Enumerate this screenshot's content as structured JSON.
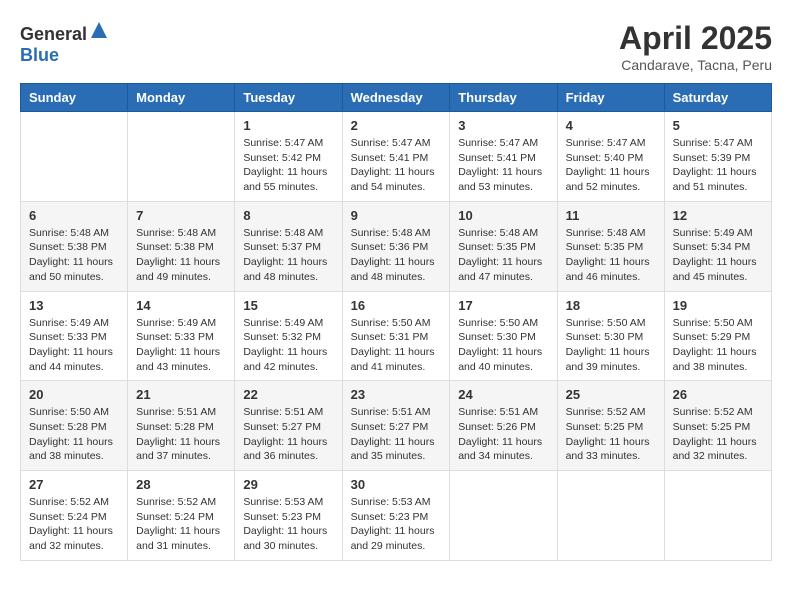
{
  "header": {
    "logo_general": "General",
    "logo_blue": "Blue",
    "title": "April 2025",
    "subtitle": "Candarave, Tacna, Peru"
  },
  "days_of_week": [
    "Sunday",
    "Monday",
    "Tuesday",
    "Wednesday",
    "Thursday",
    "Friday",
    "Saturday"
  ],
  "weeks": [
    [
      {
        "day": "",
        "sunrise": "",
        "sunset": "",
        "daylight": ""
      },
      {
        "day": "",
        "sunrise": "",
        "sunset": "",
        "daylight": ""
      },
      {
        "day": "1",
        "sunrise": "Sunrise: 5:47 AM",
        "sunset": "Sunset: 5:42 PM",
        "daylight": "Daylight: 11 hours and 55 minutes."
      },
      {
        "day": "2",
        "sunrise": "Sunrise: 5:47 AM",
        "sunset": "Sunset: 5:41 PM",
        "daylight": "Daylight: 11 hours and 54 minutes."
      },
      {
        "day": "3",
        "sunrise": "Sunrise: 5:47 AM",
        "sunset": "Sunset: 5:41 PM",
        "daylight": "Daylight: 11 hours and 53 minutes."
      },
      {
        "day": "4",
        "sunrise": "Sunrise: 5:47 AM",
        "sunset": "Sunset: 5:40 PM",
        "daylight": "Daylight: 11 hours and 52 minutes."
      },
      {
        "day": "5",
        "sunrise": "Sunrise: 5:47 AM",
        "sunset": "Sunset: 5:39 PM",
        "daylight": "Daylight: 11 hours and 51 minutes."
      }
    ],
    [
      {
        "day": "6",
        "sunrise": "Sunrise: 5:48 AM",
        "sunset": "Sunset: 5:38 PM",
        "daylight": "Daylight: 11 hours and 50 minutes."
      },
      {
        "day": "7",
        "sunrise": "Sunrise: 5:48 AM",
        "sunset": "Sunset: 5:38 PM",
        "daylight": "Daylight: 11 hours and 49 minutes."
      },
      {
        "day": "8",
        "sunrise": "Sunrise: 5:48 AM",
        "sunset": "Sunset: 5:37 PM",
        "daylight": "Daylight: 11 hours and 48 minutes."
      },
      {
        "day": "9",
        "sunrise": "Sunrise: 5:48 AM",
        "sunset": "Sunset: 5:36 PM",
        "daylight": "Daylight: 11 hours and 48 minutes."
      },
      {
        "day": "10",
        "sunrise": "Sunrise: 5:48 AM",
        "sunset": "Sunset: 5:35 PM",
        "daylight": "Daylight: 11 hours and 47 minutes."
      },
      {
        "day": "11",
        "sunrise": "Sunrise: 5:48 AM",
        "sunset": "Sunset: 5:35 PM",
        "daylight": "Daylight: 11 hours and 46 minutes."
      },
      {
        "day": "12",
        "sunrise": "Sunrise: 5:49 AM",
        "sunset": "Sunset: 5:34 PM",
        "daylight": "Daylight: 11 hours and 45 minutes."
      }
    ],
    [
      {
        "day": "13",
        "sunrise": "Sunrise: 5:49 AM",
        "sunset": "Sunset: 5:33 PM",
        "daylight": "Daylight: 11 hours and 44 minutes."
      },
      {
        "day": "14",
        "sunrise": "Sunrise: 5:49 AM",
        "sunset": "Sunset: 5:33 PM",
        "daylight": "Daylight: 11 hours and 43 minutes."
      },
      {
        "day": "15",
        "sunrise": "Sunrise: 5:49 AM",
        "sunset": "Sunset: 5:32 PM",
        "daylight": "Daylight: 11 hours and 42 minutes."
      },
      {
        "day": "16",
        "sunrise": "Sunrise: 5:50 AM",
        "sunset": "Sunset: 5:31 PM",
        "daylight": "Daylight: 11 hours and 41 minutes."
      },
      {
        "day": "17",
        "sunrise": "Sunrise: 5:50 AM",
        "sunset": "Sunset: 5:30 PM",
        "daylight": "Daylight: 11 hours and 40 minutes."
      },
      {
        "day": "18",
        "sunrise": "Sunrise: 5:50 AM",
        "sunset": "Sunset: 5:30 PM",
        "daylight": "Daylight: 11 hours and 39 minutes."
      },
      {
        "day": "19",
        "sunrise": "Sunrise: 5:50 AM",
        "sunset": "Sunset: 5:29 PM",
        "daylight": "Daylight: 11 hours and 38 minutes."
      }
    ],
    [
      {
        "day": "20",
        "sunrise": "Sunrise: 5:50 AM",
        "sunset": "Sunset: 5:28 PM",
        "daylight": "Daylight: 11 hours and 38 minutes."
      },
      {
        "day": "21",
        "sunrise": "Sunrise: 5:51 AM",
        "sunset": "Sunset: 5:28 PM",
        "daylight": "Daylight: 11 hours and 37 minutes."
      },
      {
        "day": "22",
        "sunrise": "Sunrise: 5:51 AM",
        "sunset": "Sunset: 5:27 PM",
        "daylight": "Daylight: 11 hours and 36 minutes."
      },
      {
        "day": "23",
        "sunrise": "Sunrise: 5:51 AM",
        "sunset": "Sunset: 5:27 PM",
        "daylight": "Daylight: 11 hours and 35 minutes."
      },
      {
        "day": "24",
        "sunrise": "Sunrise: 5:51 AM",
        "sunset": "Sunset: 5:26 PM",
        "daylight": "Daylight: 11 hours and 34 minutes."
      },
      {
        "day": "25",
        "sunrise": "Sunrise: 5:52 AM",
        "sunset": "Sunset: 5:25 PM",
        "daylight": "Daylight: 11 hours and 33 minutes."
      },
      {
        "day": "26",
        "sunrise": "Sunrise: 5:52 AM",
        "sunset": "Sunset: 5:25 PM",
        "daylight": "Daylight: 11 hours and 32 minutes."
      }
    ],
    [
      {
        "day": "27",
        "sunrise": "Sunrise: 5:52 AM",
        "sunset": "Sunset: 5:24 PM",
        "daylight": "Daylight: 11 hours and 32 minutes."
      },
      {
        "day": "28",
        "sunrise": "Sunrise: 5:52 AM",
        "sunset": "Sunset: 5:24 PM",
        "daylight": "Daylight: 11 hours and 31 minutes."
      },
      {
        "day": "29",
        "sunrise": "Sunrise: 5:53 AM",
        "sunset": "Sunset: 5:23 PM",
        "daylight": "Daylight: 11 hours and 30 minutes."
      },
      {
        "day": "30",
        "sunrise": "Sunrise: 5:53 AM",
        "sunset": "Sunset: 5:23 PM",
        "daylight": "Daylight: 11 hours and 29 minutes."
      },
      {
        "day": "",
        "sunrise": "",
        "sunset": "",
        "daylight": ""
      },
      {
        "day": "",
        "sunrise": "",
        "sunset": "",
        "daylight": ""
      },
      {
        "day": "",
        "sunrise": "",
        "sunset": "",
        "daylight": ""
      }
    ]
  ]
}
